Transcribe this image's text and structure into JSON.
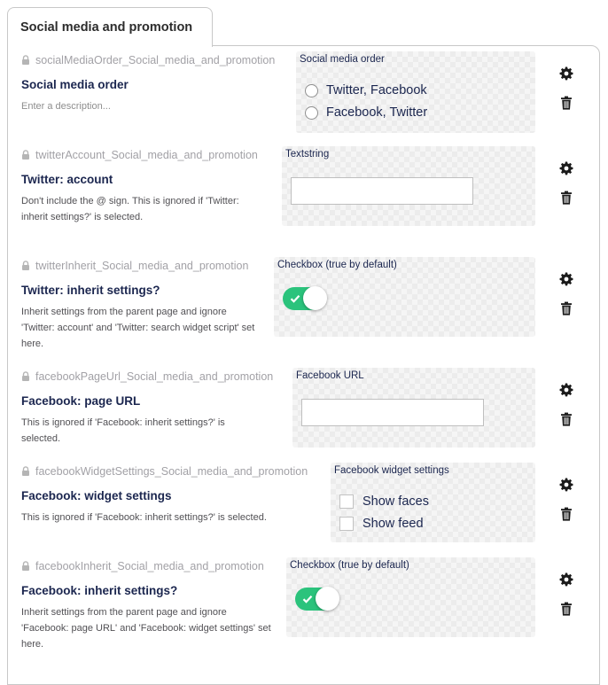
{
  "tab": {
    "label": "Social media and promotion"
  },
  "colors": {
    "toggle_on": "#2bc37c",
    "label": "#1b264f",
    "alias": "#a2a1a6"
  },
  "icons": {
    "lock": "lock-icon",
    "settings": "gear-icon",
    "delete": "trash-icon",
    "checkmark": "check-icon"
  },
  "properties": [
    {
      "alias": "socialMediaOrder_Social_media_and_promotion",
      "label": "Social media order",
      "description": "Enter a description...",
      "editor_type": "Social media order",
      "options": [
        "Twitter, Facebook",
        "Facebook, Twitter"
      ]
    },
    {
      "alias": "twitterAccount_Social_media_and_promotion",
      "label": "Twitter: account",
      "description": "Don't include the @ sign. This is ignored if 'Twitter: inherit settings?' is selected.",
      "editor_type": "Textstring",
      "value": ""
    },
    {
      "alias": "twitterInherit_Social_media_and_promotion",
      "label": "Twitter: inherit settings?",
      "description": "Inherit settings from the parent page and ignore 'Twitter: account' and 'Twitter: search widget script' set here.",
      "editor_type": "Checkbox (true by default)",
      "checked": true
    },
    {
      "alias": "facebookPageUrl_Social_media_and_promotion",
      "label": "Facebook: page URL",
      "description": "This is ignored if 'Facebook: inherit settings?' is selected.",
      "editor_type": "Facebook URL",
      "value": ""
    },
    {
      "alias": "facebookWidgetSettings_Social_media_and_promotion",
      "label": "Facebook: widget settings",
      "description": "This is ignored if 'Facebook: inherit settings?' is selected.",
      "editor_type": "Facebook widget settings",
      "options": [
        "Show faces",
        "Show feed"
      ]
    },
    {
      "alias": "facebookInherit_Social_media_and_promotion",
      "label": "Facebook: inherit settings?",
      "description": "Inherit settings from the parent page and ignore 'Facebook: page URL' and 'Facebook: widget settings' set here.",
      "editor_type": "Checkbox (true by default)",
      "checked": true
    }
  ]
}
